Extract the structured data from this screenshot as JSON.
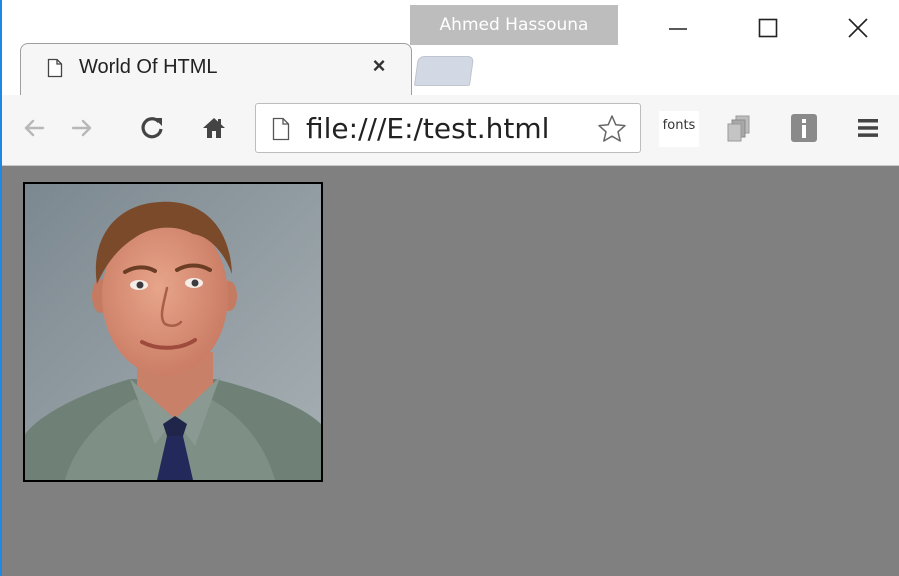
{
  "window": {
    "profile_name": "Ahmed Hassouna",
    "controls": {
      "minimize": "minimize",
      "maximize": "maximize",
      "close": "close"
    }
  },
  "tab": {
    "title": "World Of HTML",
    "close_glyph": "×",
    "icon": "page-icon"
  },
  "toolbar": {
    "back": "back-arrow-icon",
    "forward": "forward-arrow-icon",
    "reload": "reload-icon",
    "home": "home-icon",
    "address": "file:///E:/test.html",
    "bookmark": "star-icon",
    "extensions": [
      {
        "name": "fonts-extension",
        "label": "fonts"
      },
      {
        "name": "copy-extension",
        "icon": "pages-icon"
      },
      {
        "name": "info-extension",
        "icon": "info-icon"
      }
    ],
    "menu": "hamburger-menu-icon"
  },
  "page": {
    "background": "#808080",
    "image": {
      "subject": "portrait photo of a man in a grey shirt and dark patterned tie",
      "border_color": "#000000"
    }
  },
  "colors": {
    "profile_bg": "#bdbdbd",
    "tab_bg": "#f6f6f6",
    "newtab_bg": "#d3d9e4",
    "window_accent": "#1e88e5"
  }
}
